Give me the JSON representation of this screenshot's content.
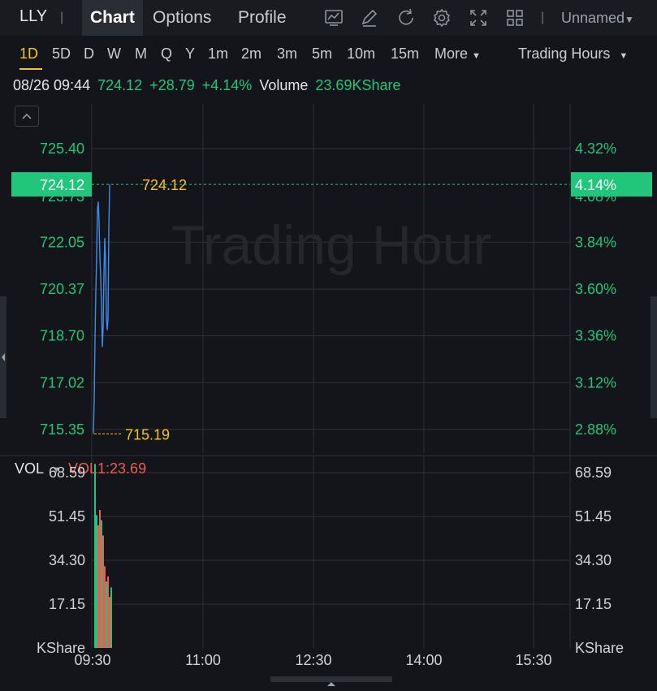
{
  "header": {
    "symbol": "LLY",
    "tabs": [
      {
        "label": "Chart",
        "active": true
      },
      {
        "label": "Options",
        "active": false
      },
      {
        "label": "Profile",
        "active": false
      }
    ],
    "icons": [
      "chart-settings-icon",
      "draw-pen-icon",
      "refresh-icon",
      "gear-icon",
      "fullscreen-icon",
      "grid-layout-icon"
    ],
    "layout_name": "Unnamed"
  },
  "periods": {
    "items": [
      "1D",
      "5D",
      "D",
      "W",
      "M",
      "Q",
      "Y",
      "1m",
      "2m",
      "3m",
      "5m",
      "10m",
      "15m"
    ],
    "active": "1D",
    "more_label": "More",
    "session_label": "Trading Hours"
  },
  "quote": {
    "datetime": "08/26 09:44",
    "price": "724.12",
    "change": "+28.79",
    "change_pct": "+4.14%",
    "volume_label": "Volume",
    "volume_value": "23.69KShare"
  },
  "colors": {
    "up": "#22c57c",
    "down": "#f05a4f",
    "line": "#3d8eea",
    "highlight": "#f5c518",
    "background": "#14151a",
    "grid": "#2e3038"
  },
  "chart_data": [
    {
      "type": "line",
      "title": "",
      "watermark": "Trading Hour",
      "x_ticks": [
        "09:30",
        "11:00",
        "12:30",
        "14:00",
        "15:30"
      ],
      "ylim": [
        714.5,
        727.0
      ],
      "y_ticks": [
        725.4,
        722.05,
        720.37,
        718.7,
        717.02,
        715.35
      ],
      "y_tick_labels": [
        "725.40",
        "722.05",
        "720.37",
        "718.70",
        "717.02",
        "715.35"
      ],
      "y_right_ticks": [
        4.32,
        3.84,
        3.6,
        3.36,
        3.12,
        2.88
      ],
      "y_right_labels": [
        "4.32%",
        "3.84%",
        "3.60%",
        "3.36%",
        "3.12%",
        "2.88%"
      ],
      "hidden_tick_label": "723.73",
      "hidden_right_label": "4.08%",
      "current_price": 724.12,
      "current_price_label": "724.12",
      "current_pct_label": "4.14%",
      "low_price": 715.19,
      "low_label": "715.19",
      "high_label": "724.12",
      "series": [
        {
          "values": [
            715.19,
            716.4,
            718.6,
            720.3,
            721.5,
            723.2,
            723.5,
            722.8,
            721.5,
            720.8,
            719.8,
            718.3,
            719.0,
            720.9,
            722.2,
            721.3,
            719.4,
            718.9,
            719.3,
            722.5,
            724.12
          ]
        }
      ]
    },
    {
      "type": "bar",
      "indicator_label": "VOL",
      "indicator_value": "VOL1:23.69",
      "unit_label": "KShare",
      "ylim": [
        0,
        75
      ],
      "y_ticks": [
        68.59,
        51.45,
        34.3,
        17.15
      ],
      "y_tick_labels": [
        "68.59",
        "51.45",
        "34.30",
        "17.15"
      ],
      "bars": [
        {
          "value": 72.0,
          "up": true
        },
        {
          "value": 52.0,
          "up": true
        },
        {
          "value": 48.0,
          "up": false
        },
        {
          "value": 54.0,
          "up": false
        },
        {
          "value": 50.0,
          "up": true
        },
        {
          "value": 44.0,
          "up": false
        },
        {
          "value": 32.0,
          "up": false
        },
        {
          "value": 26.0,
          "up": true
        },
        {
          "value": 28.0,
          "up": false
        },
        {
          "value": 20.0,
          "up": false
        },
        {
          "value": 23.69,
          "up": true
        }
      ]
    }
  ]
}
